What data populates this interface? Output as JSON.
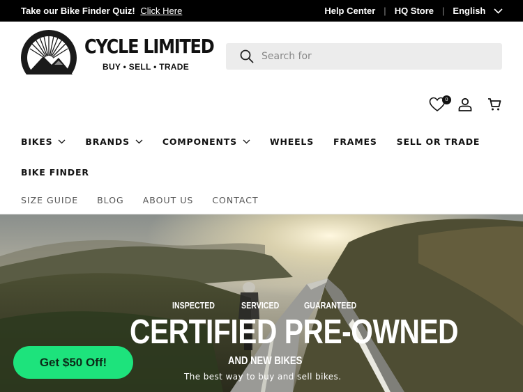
{
  "announcement": {
    "promo_text": "Take our Bike Finder Quiz!",
    "promo_link": "Click Here",
    "help_center": "Help Center",
    "hq_store": "HQ Store",
    "language": "English"
  },
  "brand": {
    "name": "CYCLE LIMITED",
    "tagline": "BUY • SELL • TRADE"
  },
  "search": {
    "placeholder": "Search for"
  },
  "header": {
    "wishlist_count": "0"
  },
  "nav_primary": [
    {
      "label": "BIKES"
    },
    {
      "label": "BRANDS"
    },
    {
      "label": "COMPONENTS"
    },
    {
      "label": "WHEELS"
    },
    {
      "label": "FRAMES"
    },
    {
      "label": "SELL OR TRADE"
    }
  ],
  "nav_primary_row2": [
    {
      "label": "BIKE FINDER"
    }
  ],
  "nav_secondary": [
    {
      "label": "SIZE GUIDE"
    },
    {
      "label": "BLOG"
    },
    {
      "label": "ABOUT US"
    },
    {
      "label": "CONTACT"
    }
  ],
  "hero": {
    "label_1": "INSPECTED",
    "label_2": "SERVICED",
    "label_3": "GUARANTEED",
    "headline": "CERTIFIED PRE-OWNED",
    "subheadline": "AND NEW BIKES",
    "tagline": "The best way to buy and sell bikes."
  },
  "promo_button": {
    "label": "Get $50 Off!"
  },
  "colors": {
    "topbar_bg": "#000000",
    "promo_button_bg": "#1de37c",
    "search_bg": "#ececec"
  }
}
